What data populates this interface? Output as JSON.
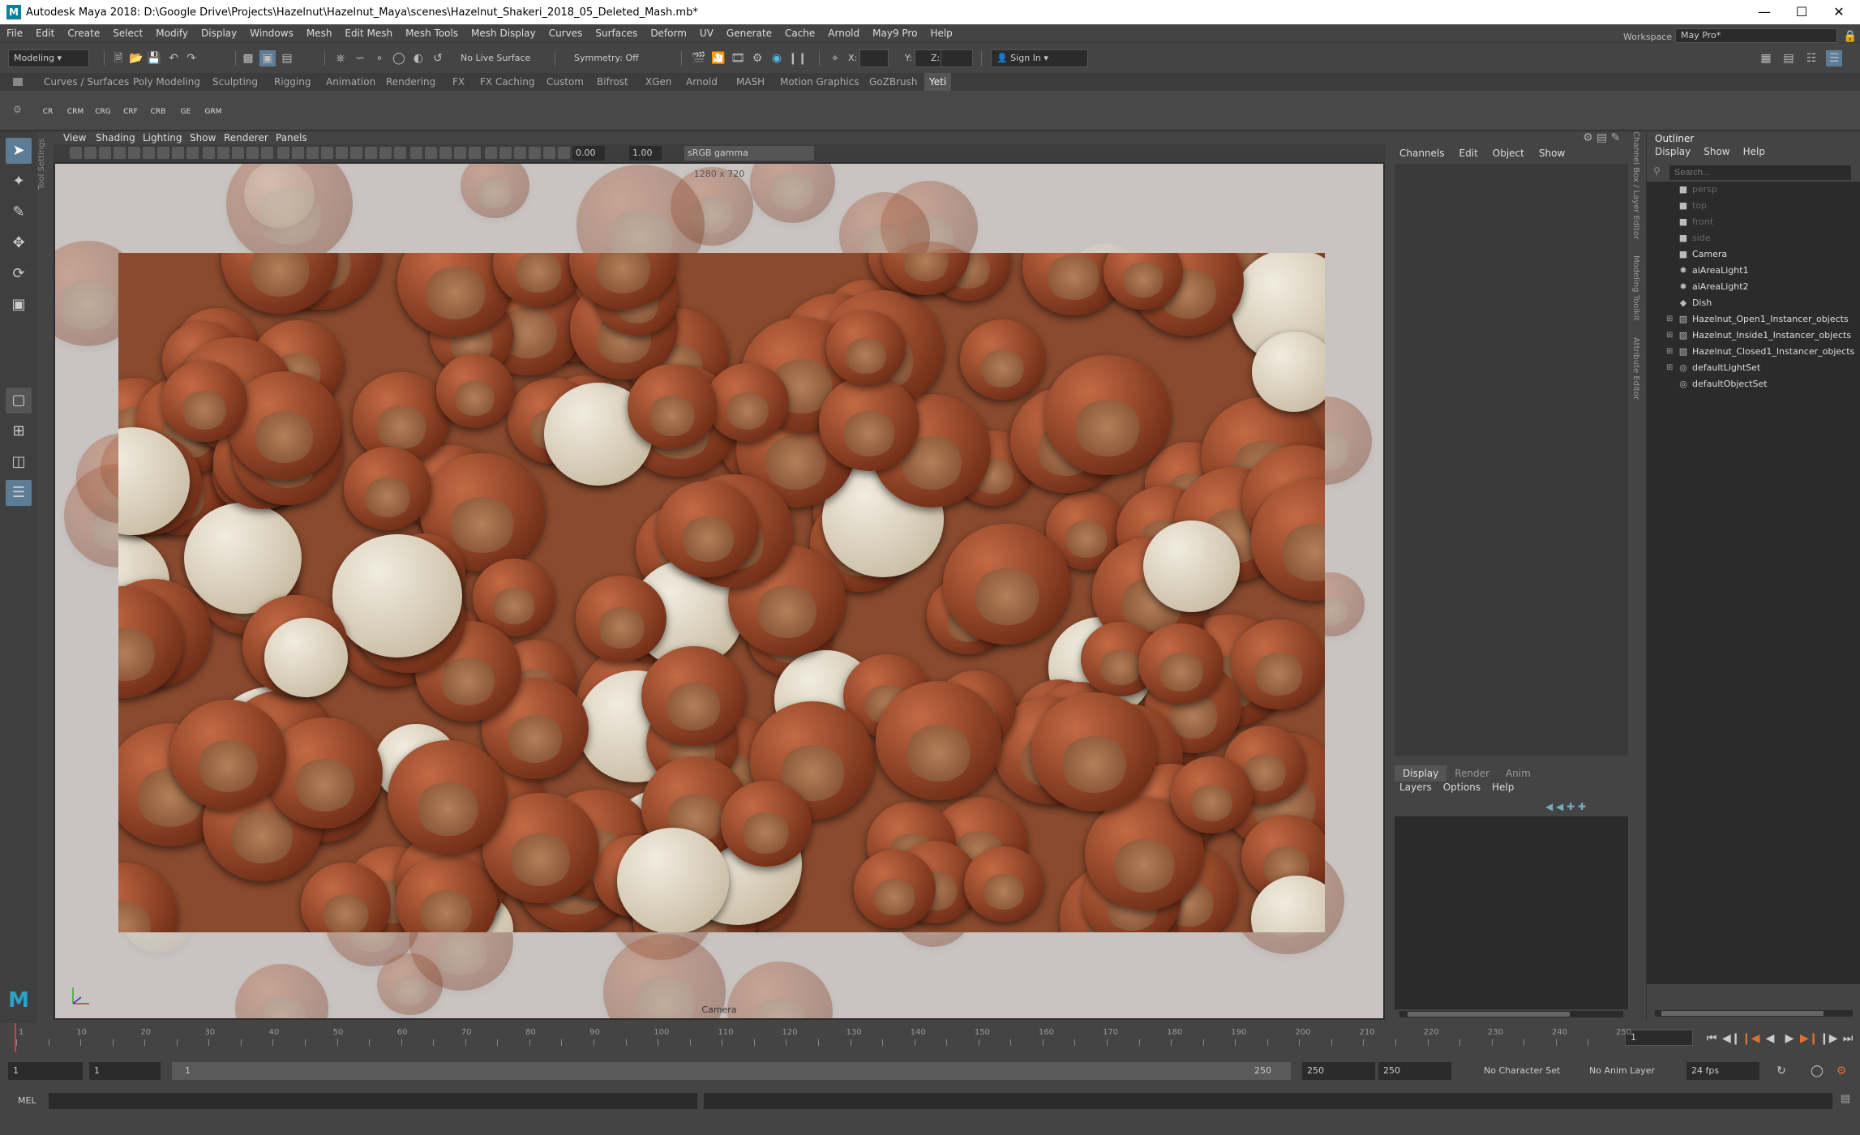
{
  "window": {
    "title": "Autodesk Maya 2018: D:\\Google Drive\\Projects\\Hazelnut\\Hazelnut_Maya\\scenes\\Hazelnut_Shakeri_2018_05_Deleted_Mash.mb*"
  },
  "menu": [
    "File",
    "Edit",
    "Create",
    "Select",
    "Modify",
    "Display",
    "Windows",
    "Mesh",
    "Edit Mesh",
    "Mesh Tools",
    "Mesh Display",
    "Curves",
    "Surfaces",
    "Deform",
    "UV",
    "Generate",
    "Cache",
    "Arnold",
    "May9 Pro",
    "Help"
  ],
  "status": {
    "menuset": "Modeling",
    "live_surface": "No Live Surface",
    "symmetry": "Symmetry: Off",
    "x_label": "X:",
    "y_label": "Y:",
    "z_label": "Z:",
    "sign_in": "Sign In",
    "workspace_label": "Workspace :",
    "workspace_value": "May Pro*"
  },
  "shelf_tabs": [
    "Curves / Surfaces",
    "Poly Modeling",
    "Sculpting",
    "Rigging",
    "Animation",
    "Rendering",
    "FX",
    "FX Caching",
    "Custom",
    "Bifrost",
    "XGen",
    "Arnold",
    "MASH",
    "Motion Graphics",
    "GoZBrush",
    "Yeti"
  ],
  "shelf_tab_active": "Yeti",
  "shelf_icons": [
    "CR",
    "CRM",
    "CRG",
    "CRF",
    "CRB",
    "GE",
    "GRM"
  ],
  "tool_settings_label": "Tool Settings",
  "panel_menu": [
    "View",
    "Shading",
    "Lighting",
    "Show",
    "Renderer",
    "Panels"
  ],
  "viewport": {
    "exposure": "0.00",
    "gamma": "1.00",
    "color_space": "sRGB gamma",
    "resolution": "1280 x 720",
    "camera": "Camera"
  },
  "channel_box": {
    "menu": [
      "Channels",
      "Edit",
      "Object",
      "Show"
    ]
  },
  "layer_editor": {
    "tabs": [
      "Display",
      "Render",
      "Anim"
    ],
    "active_tab": "Display",
    "menu": [
      "Layers",
      "Options",
      "Help"
    ]
  },
  "side_tabs": [
    "Channel Box / Layer Editor",
    "Modeling Toolkit",
    "Attribute Editor"
  ],
  "outliner": {
    "title": "Outliner",
    "menu": [
      "Display",
      "Show",
      "Help"
    ],
    "search_placeholder": "Search...",
    "items": [
      {
        "label": "persp",
        "icon": "camera-icon",
        "dim": true,
        "expand": false
      },
      {
        "label": "top",
        "icon": "camera-icon",
        "dim": true,
        "expand": false
      },
      {
        "label": "front",
        "icon": "camera-icon",
        "dim": true,
        "expand": false
      },
      {
        "label": "side",
        "icon": "camera-icon",
        "dim": true,
        "expand": false
      },
      {
        "label": "Camera",
        "icon": "camera-icon",
        "dim": false,
        "expand": false
      },
      {
        "label": "aiAreaLight1",
        "icon": "light-icon",
        "dim": false,
        "expand": false
      },
      {
        "label": "aiAreaLight2",
        "icon": "light-icon",
        "dim": false,
        "expand": false
      },
      {
        "label": "Dish",
        "icon": "mesh-icon",
        "dim": false,
        "expand": false
      },
      {
        "label": "Hazelnut_Open1_Instancer_objects",
        "icon": "instancer-icon",
        "dim": false,
        "expand": true
      },
      {
        "label": "Hazelnut_Inside1_Instancer_objects",
        "icon": "instancer-icon",
        "dim": false,
        "expand": true
      },
      {
        "label": "Hazelnut_Closed1_Instancer_objects",
        "icon": "instancer-icon",
        "dim": false,
        "expand": true
      },
      {
        "label": "defaultLightSet",
        "icon": "set-icon",
        "dim": false,
        "expand": true
      },
      {
        "label": "defaultObjectSet",
        "icon": "set-icon",
        "dim": false,
        "expand": false
      }
    ]
  },
  "timeline": {
    "ticks": [
      "1",
      "10",
      "20",
      "30",
      "40",
      "50",
      "60",
      "70",
      "80",
      "90",
      "100",
      "110",
      "120",
      "130",
      "140",
      "150",
      "160",
      "170",
      "180",
      "190",
      "200",
      "210",
      "220",
      "230",
      "240",
      "250"
    ],
    "current_frame": "1"
  },
  "range": {
    "start": "1",
    "playback_start": "1",
    "slider_start": "1",
    "slider_end": "250",
    "playback_end": "250",
    "end": "250",
    "character_set": "No Character Set",
    "anim_layer": "No Anim Layer",
    "fps": "24 fps"
  },
  "command_line": {
    "label": "MEL"
  }
}
